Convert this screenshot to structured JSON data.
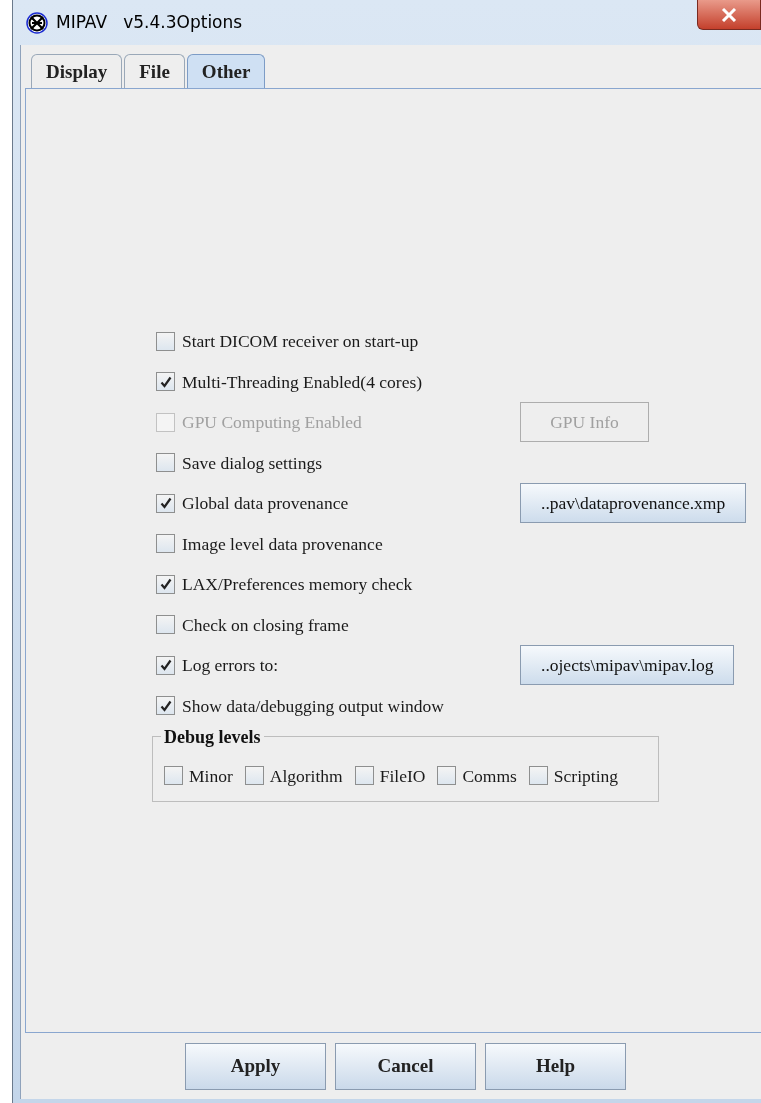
{
  "window": {
    "title": "MIPAV   v5.4.3Options"
  },
  "tabs": [
    {
      "label": "Display",
      "selected": false
    },
    {
      "label": "File",
      "selected": false
    },
    {
      "label": "Other",
      "selected": true
    }
  ],
  "options": [
    {
      "label": "Start DICOM receiver on start-up",
      "checked": false,
      "disabled": false
    },
    {
      "label": "Multi-Threading Enabled(4 cores)",
      "checked": true,
      "disabled": false
    },
    {
      "label": "GPU Computing Enabled",
      "checked": false,
      "disabled": true,
      "button": {
        "label": "GPU Info",
        "disabled": true
      }
    },
    {
      "label": "Save dialog settings",
      "checked": false,
      "disabled": false
    },
    {
      "label": "Global data provenance",
      "checked": true,
      "disabled": false,
      "button": {
        "label": "..pav\\dataprovenance.xmp",
        "disabled": false
      }
    },
    {
      "label": "Image level data provenance",
      "checked": false,
      "disabled": false
    },
    {
      "label": "LAX/Preferences memory check",
      "checked": true,
      "disabled": false
    },
    {
      "label": "Check on closing frame",
      "checked": false,
      "disabled": false
    },
    {
      "label": "Log errors to:",
      "checked": true,
      "disabled": false,
      "button": {
        "label": "..ojects\\mipav\\mipav.log",
        "disabled": false
      }
    },
    {
      "label": "Show data/debugging output window",
      "checked": true,
      "disabled": false
    }
  ],
  "debug_levels": {
    "title": "Debug levels",
    "items": [
      {
        "label": "Minor",
        "checked": false
      },
      {
        "label": "Algorithm",
        "checked": false
      },
      {
        "label": "FileIO",
        "checked": false
      },
      {
        "label": "Comms",
        "checked": false
      },
      {
        "label": "Scripting",
        "checked": false
      }
    ]
  },
  "buttons": [
    "Apply",
    "Cancel",
    "Help"
  ]
}
